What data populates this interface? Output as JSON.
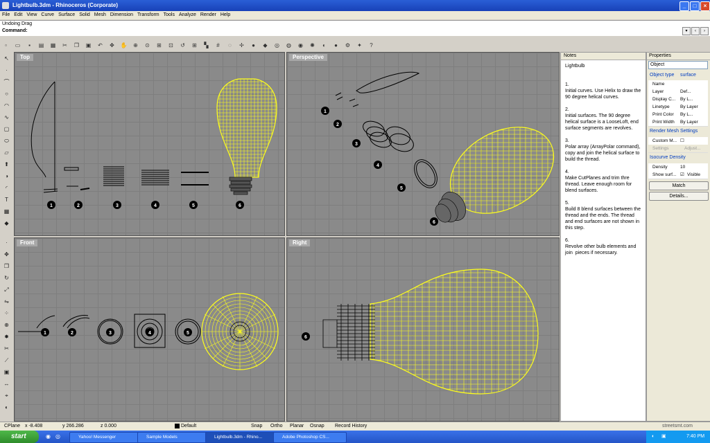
{
  "window": {
    "title": "Lightbulb.3dm - Rhinoceros (Corporate)",
    "min_icon": "minimize-icon",
    "max_icon": "maximize-icon",
    "close_icon": "close-icon"
  },
  "menu": [
    "File",
    "Edit",
    "View",
    "Curve",
    "Surface",
    "Solid",
    "Mesh",
    "Dimension",
    "Transform",
    "Tools",
    "Analyze",
    "Render",
    "Help"
  ],
  "command": {
    "history": "Undoing Drag",
    "prompt": "Command:"
  },
  "viewports": {
    "top": "Top",
    "perspective": "Perspective",
    "front": "Front",
    "right": "Right"
  },
  "markers": [
    "1",
    "2",
    "3",
    "4",
    "5",
    "6"
  ],
  "notes": {
    "header": "Notes",
    "text": "Lightbulb\n\n\n1.\nInitial curves. Use Helix to draw the 90 degree helical curves.\n\n2.\nInitial surfaces. The 90 degree helical surface is a LooseLoft, end surface segments are revolves.\n\n3.\nPolar array (ArrayPolar command), copy and join the helical surface to build the thread.\n\n4.\nMake CutPlanes and trim thre thread. Leave enough room for blend surfaces.\n\n5.\nBuild 8 blend surfaces between the thread and the ends. The thread and end surfaces are not shown in this step.\n\n6.\nRevolve other bulb elements and join  pieces if necessary."
  },
  "properties": {
    "header": "Properties",
    "selector": "Object",
    "object_type_label": "Object type",
    "object_type_value": "surface",
    "rows": [
      {
        "k": "Name",
        "v": ""
      },
      {
        "k": "Layer",
        "v": "Def..."
      },
      {
        "k": "Display C...",
        "v": "By L..."
      },
      {
        "k": "Linetype",
        "v": "By Layer"
      },
      {
        "k": "Print Color",
        "v": "By L..."
      },
      {
        "k": "Print Width",
        "v": "By Layer"
      }
    ],
    "render_mesh_label": "Render Mesh Settings",
    "custom_mesh": "Custom M...",
    "settings_btn": "Settings",
    "adjust_btn": "Adjust...",
    "isocurve_label": "Isocurve Density",
    "density_label": "Density",
    "density_value": "10",
    "show_surf_label": "Show surf...",
    "visible_label": "Visible",
    "match_btn": "Match",
    "details_btn": "Details..."
  },
  "status": {
    "cplane": "CPlane",
    "x": "x -8.408",
    "y": "y 266.286",
    "z": "z 0.000",
    "layer": "Default",
    "snap": "Snap",
    "ortho": "Ortho",
    "planar": "Planar",
    "osnap": "Osnap",
    "record": "Record History",
    "watermark": "streetsmt.com"
  },
  "taskbar": {
    "start": "start",
    "tasks": [
      "Yahoo! Messenger",
      "Sample Models",
      "Lightbulb.3dm - Rhino...",
      "Adobe Photoshop CS..."
    ],
    "clock": "7:40 PM"
  },
  "colors": {
    "wire": "#ffff1a",
    "viewport_bg": "#8a8a8a",
    "title_bar": "#2a5fd6"
  }
}
